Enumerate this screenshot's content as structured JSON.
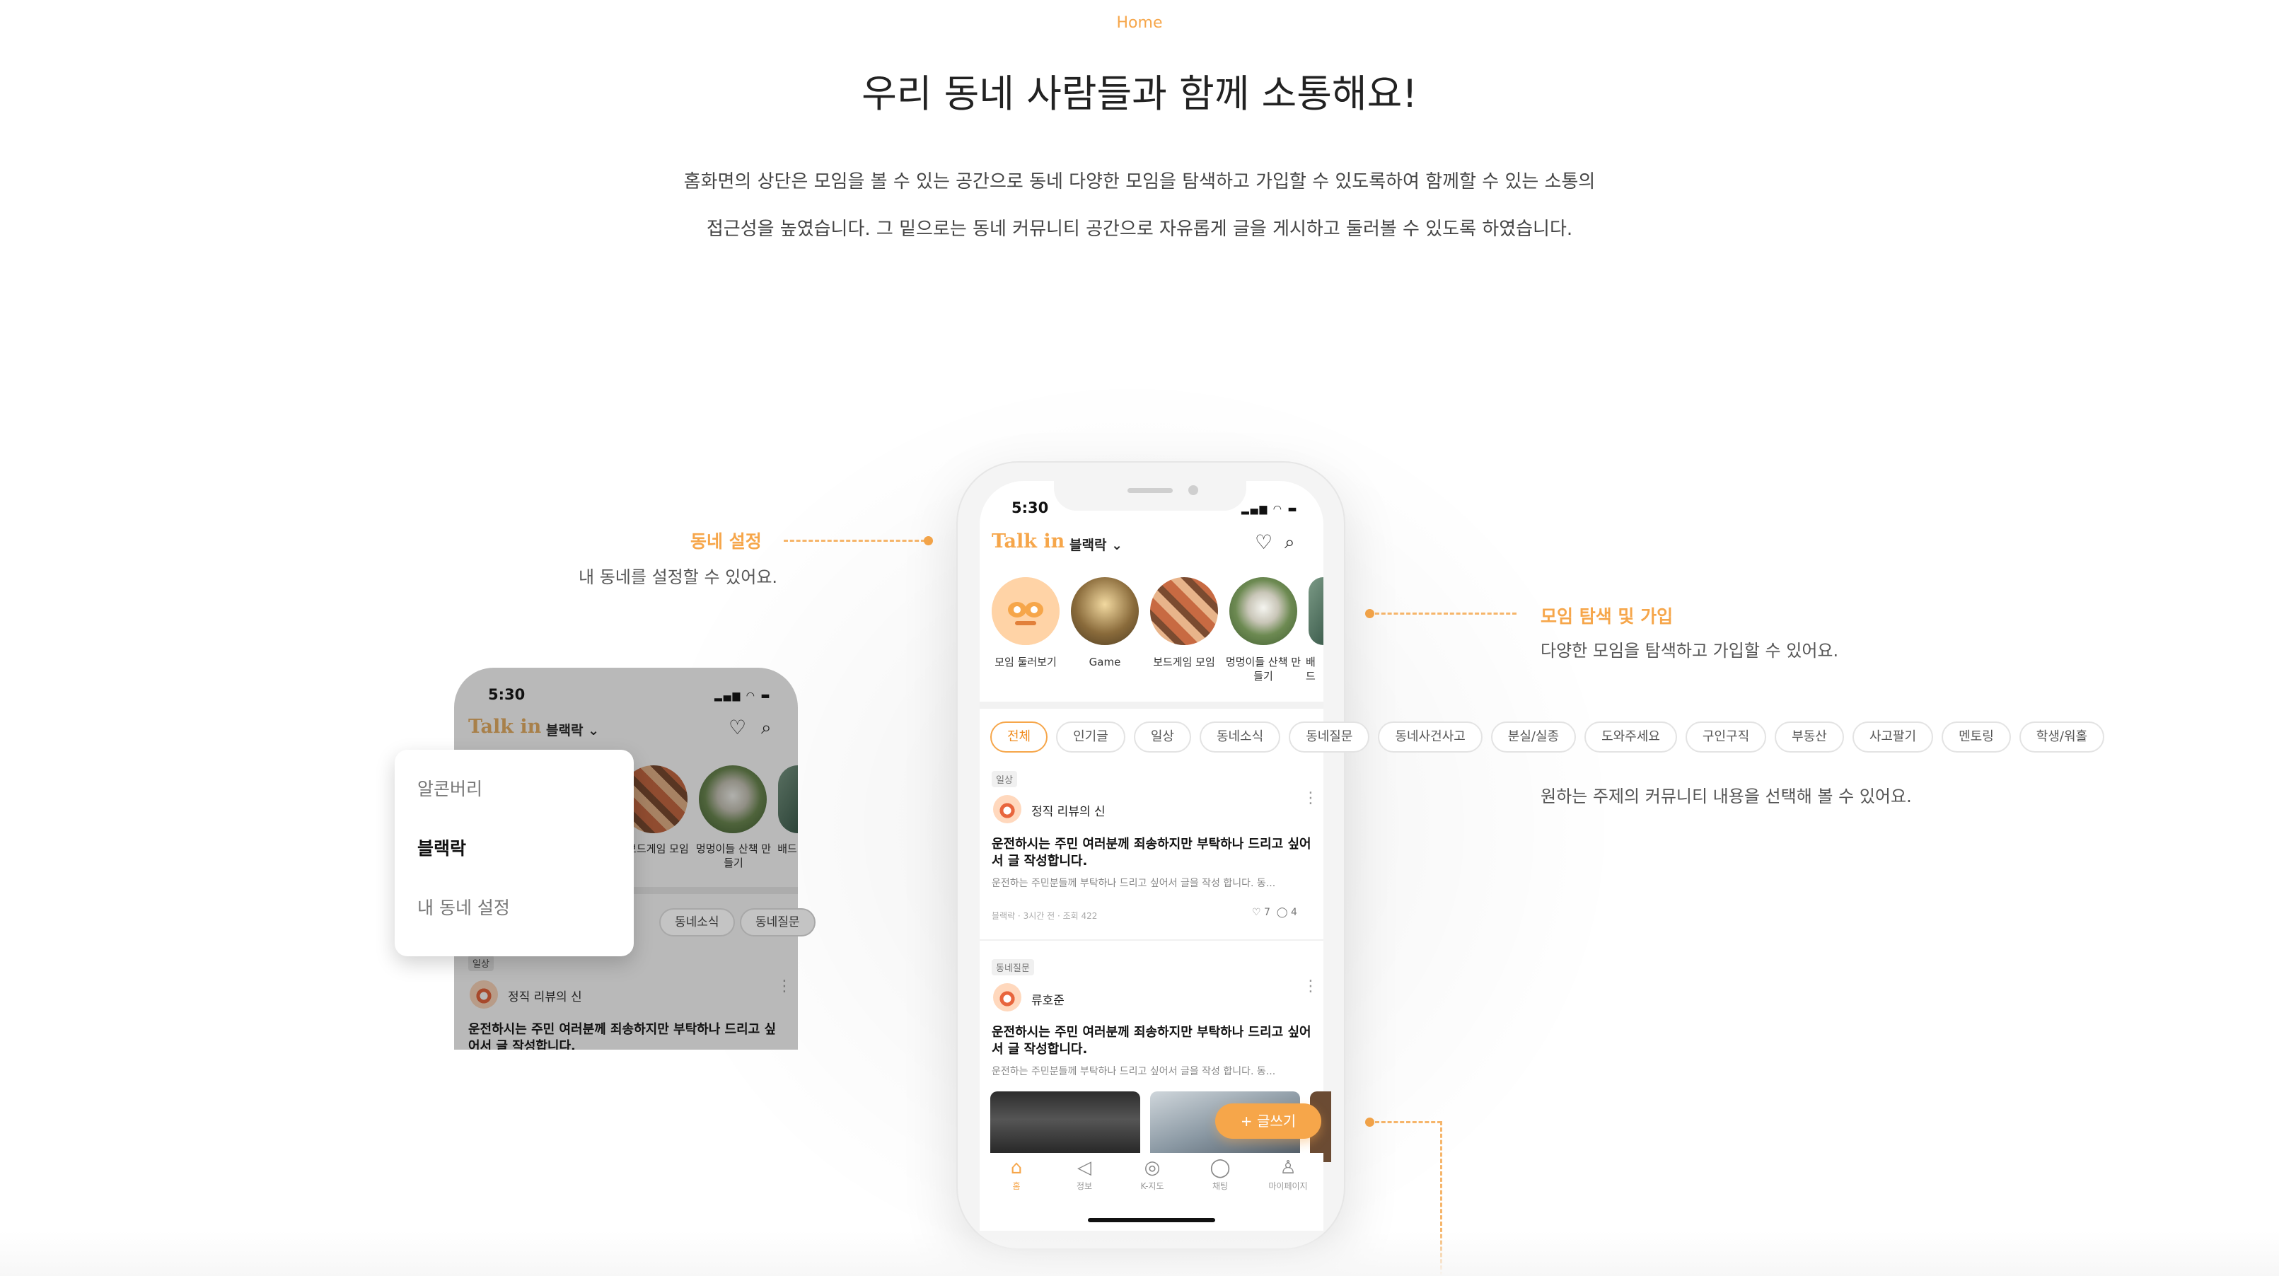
{
  "header": {
    "eyebrow": "Home",
    "title": "우리 동네 사람들과 함께 소통해요!",
    "intro_line1": "홈화면의 상단은 모임을 볼 수 있는 공간으로 동네 다양한 모임을 탐색하고 가입할 수 있도록하여 함께할 수 있는 소통의",
    "intro_line2": "접근성을 높였습니다. 그 밑으로는 동네 커뮤니티 공간으로 자유롭게 글을 게시하고 둘러볼 수 있도록 하였습니다."
  },
  "annotations": {
    "town": {
      "title": "동네 설정",
      "desc": "내 동네를 설정할 수 있어요."
    },
    "group": {
      "title": "모임 탐색 및 가입",
      "desc": "다양한 모임을 탐색하고 가입할 수 있어요."
    },
    "topic": {
      "desc": "원하는 주제의 커뮤니티 내용을 선택해 볼 수 있어요."
    }
  },
  "app": {
    "time": "5:30",
    "logo": "Talk in",
    "town": "블랙락",
    "groups": [
      {
        "label": "모임 둘러보기"
      },
      {
        "label": "Game"
      },
      {
        "label": "보드게임 모임"
      },
      {
        "label": "멍멍이들 산책 만들기"
      },
      {
        "label": "배드"
      }
    ],
    "categories": [
      "전체",
      "인기글",
      "일상",
      "동네소식",
      "동네질문",
      "동네사건사고",
      "분실/실종",
      "도와주세요",
      "구인구직",
      "부동산",
      "사고팔기",
      "멘토링",
      "학생/워홀"
    ],
    "posts": [
      {
        "tag": "일상",
        "author": "정직 리뷰의 신",
        "title": "운전하시는 주민 여러분께 죄송하지만 부탁하나 드리고 싶어서 글 작성합니다.",
        "body": "운전하는 주민분들께 부탁하나 드리고 싶어서 글을 작성 합니다. 동...",
        "meta": "블랙락 · 3시간 전 · 조회 422",
        "likes": "7",
        "comments": "4"
      },
      {
        "tag": "동네질문",
        "author": "류호준",
        "title": "운전하시는 주민 여러분께 죄송하지만 부탁하나 드리고 싶어서 글 작성합니다.",
        "body": "운전하는 주민분들께 부탁하나 드리고 싶어서 글을 작성 합니다. 동..."
      }
    ],
    "fab_label": "+ 글쓰기",
    "tabs": [
      {
        "label": "홈",
        "icon": "home-icon"
      },
      {
        "label": "정보",
        "icon": "megaphone-icon"
      },
      {
        "label": "K-지도",
        "icon": "map-pin-icon"
      },
      {
        "label": "채팅",
        "icon": "chat-icon"
      },
      {
        "label": "마이페이지",
        "icon": "user-icon"
      }
    ]
  },
  "secondary": {
    "time": "5:30",
    "logo": "Talk in",
    "town": "블랙락",
    "groups": [
      {
        "label": "보드게임 모임"
      },
      {
        "label": "멍멍이들 산책 만들기"
      },
      {
        "label": "배드"
      }
    ],
    "chips": [
      "동네소식",
      "동네질문"
    ],
    "post_tag": "일상",
    "post_author": "정직 리뷰의 신",
    "post_title": "운전하시는 주민 여러분께 죄송하지만 부탁하나 드리고 싶어서 글 작성합니다.",
    "dropdown": [
      {
        "label": "알콘버리",
        "selected": false
      },
      {
        "label": "블랙락",
        "selected": true
      },
      {
        "label": "내 동네 설정",
        "selected": false
      }
    ]
  },
  "colors": {
    "accent": "#f6a64a",
    "text": "#222222"
  }
}
